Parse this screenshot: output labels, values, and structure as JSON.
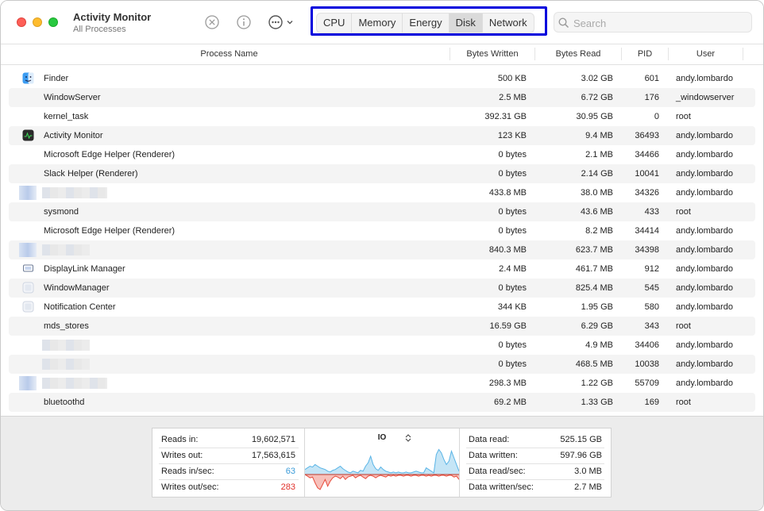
{
  "app": {
    "title": "Activity Monitor",
    "subtitle": "All Processes"
  },
  "tabs": [
    "CPU",
    "Memory",
    "Energy",
    "Disk",
    "Network"
  ],
  "active_tab": "Disk",
  "search": {
    "placeholder": "Search",
    "value": ""
  },
  "columns": {
    "name": "Process Name",
    "bytes_written": "Bytes Written",
    "bytes_read": "Bytes Read",
    "pid": "PID",
    "user": "User"
  },
  "rows": [
    {
      "name": "Finder",
      "bytes_written": "500 KB",
      "bytes_read": "3.02 GB",
      "pid": "601",
      "user": "andy.lombardo",
      "icon": "finder-icon"
    },
    {
      "name": "WindowServer",
      "bytes_written": "2.5 MB",
      "bytes_read": "6.72 GB",
      "pid": "176",
      "user": "_windowserver",
      "icon": ""
    },
    {
      "name": "kernel_task",
      "bytes_written": "392.31 GB",
      "bytes_read": "30.95 GB",
      "pid": "0",
      "user": "root",
      "icon": ""
    },
    {
      "name": "Activity Monitor",
      "bytes_written": "123 KB",
      "bytes_read": "9.4 MB",
      "pid": "36493",
      "user": "andy.lombardo",
      "icon": "activity-monitor-icon"
    },
    {
      "name": "Microsoft Edge Helper (Renderer)",
      "bytes_written": "0 bytes",
      "bytes_read": "2.1 MB",
      "pid": "34466",
      "user": "andy.lombardo",
      "icon": ""
    },
    {
      "name": "Slack Helper (Renderer)",
      "bytes_written": "0 bytes",
      "bytes_read": "2.14 GB",
      "pid": "10041",
      "user": "andy.lombardo",
      "icon": ""
    },
    {
      "name": "",
      "bytes_written": "433.8 MB",
      "bytes_read": "38.0 MB",
      "pid": "34326",
      "user": "andy.lombardo",
      "icon": "redacted-app-icon"
    },
    {
      "name": "sysmond",
      "bytes_written": "0 bytes",
      "bytes_read": "43.6 MB",
      "pid": "433",
      "user": "root",
      "icon": ""
    },
    {
      "name": "Microsoft Edge Helper (Renderer)",
      "bytes_written": "0 bytes",
      "bytes_read": "8.2 MB",
      "pid": "34414",
      "user": "andy.lombardo",
      "icon": ""
    },
    {
      "name": "",
      "bytes_written": "840.3 MB",
      "bytes_read": "623.7 MB",
      "pid": "34398",
      "user": "andy.lombardo",
      "icon": "redacted-app-icon"
    },
    {
      "name": "DisplayLink Manager",
      "bytes_written": "2.4 MB",
      "bytes_read": "461.7 MB",
      "pid": "912",
      "user": "andy.lombardo",
      "icon": "displaylink-icon"
    },
    {
      "name": "WindowManager",
      "bytes_written": "0 bytes",
      "bytes_read": "825.4 MB",
      "pid": "545",
      "user": "andy.lombardo",
      "icon": "window-manager-icon"
    },
    {
      "name": "Notification Center",
      "bytes_written": "344 KB",
      "bytes_read": "1.95 GB",
      "pid": "580",
      "user": "andy.lombardo",
      "icon": "notification-center-icon"
    },
    {
      "name": "mds_stores",
      "bytes_written": "16.59 GB",
      "bytes_read": "6.29 GB",
      "pid": "343",
      "user": "root",
      "icon": ""
    },
    {
      "name": "",
      "bytes_written": "0 bytes",
      "bytes_read": "4.9 MB",
      "pid": "34406",
      "user": "andy.lombardo",
      "icon": ""
    },
    {
      "name": "",
      "bytes_written": "0 bytes",
      "bytes_read": "468.5 MB",
      "pid": "10038",
      "user": "andy.lombardo",
      "icon": ""
    },
    {
      "name": "",
      "bytes_written": "298.3 MB",
      "bytes_read": "1.22 GB",
      "pid": "55709",
      "user": "andy.lombardo",
      "icon": "redacted-app-icon"
    },
    {
      "name": "bluetoothd",
      "bytes_written": "69.2 MB",
      "bytes_read": "1.33 GB",
      "pid": "169",
      "user": "root",
      "icon": ""
    }
  ],
  "footer": {
    "left": [
      {
        "label": "Reads in:",
        "value": "19,602,571",
        "color": "#222222"
      },
      {
        "label": "Writes out:",
        "value": "17,563,615",
        "color": "#222222"
      },
      {
        "label": "Reads in/sec:",
        "value": "63",
        "color": "#3a9bd9"
      },
      {
        "label": "Writes out/sec:",
        "value": "283",
        "color": "#e0302a"
      }
    ],
    "graph_selector": "IO",
    "right": [
      {
        "label": "Data read:",
        "value": "525.15 GB"
      },
      {
        "label": "Data written:",
        "value": "597.96 GB"
      },
      {
        "label": "Data read/sec:",
        "value": "3.0 MB"
      },
      {
        "label": "Data written/sec:",
        "value": "2.7 MB"
      }
    ]
  },
  "chart_data": {
    "type": "area",
    "series": [
      {
        "color": "#59b4e6",
        "values": [
          6,
          8,
          10,
          9,
          12,
          10,
          8,
          7,
          6,
          4,
          3,
          5,
          6,
          8,
          10,
          7,
          5,
          3,
          2,
          4,
          3,
          2,
          5,
          4,
          10,
          14,
          22,
          12,
          7,
          5,
          9,
          6,
          4,
          3,
          2,
          3,
          2,
          3,
          2,
          2,
          3,
          2,
          2,
          3,
          4,
          3,
          2,
          2,
          8,
          6,
          4,
          2,
          24,
          30,
          26,
          18,
          12,
          16,
          28,
          20,
          12,
          4
        ]
      },
      {
        "color": "#e74c3c",
        "values": [
          0,
          -2,
          -4,
          -3,
          -10,
          -16,
          -18,
          -12,
          -6,
          -14,
          -8,
          -4,
          -2,
          -3,
          -5,
          -2,
          -6,
          -3,
          -2,
          -1,
          -4,
          -2,
          -1,
          -3,
          -5,
          -2,
          -1,
          -2,
          -4,
          -2,
          -1,
          -2,
          -3,
          -1,
          -2,
          -1,
          -2,
          -1,
          -1,
          -2,
          -1,
          -1,
          -2,
          -1,
          -1,
          -2,
          -1,
          -1,
          -2,
          -1,
          -2,
          -1,
          -1,
          -2,
          -1,
          -1,
          -2,
          -1,
          -1,
          -3,
          -2,
          -6
        ]
      }
    ]
  }
}
